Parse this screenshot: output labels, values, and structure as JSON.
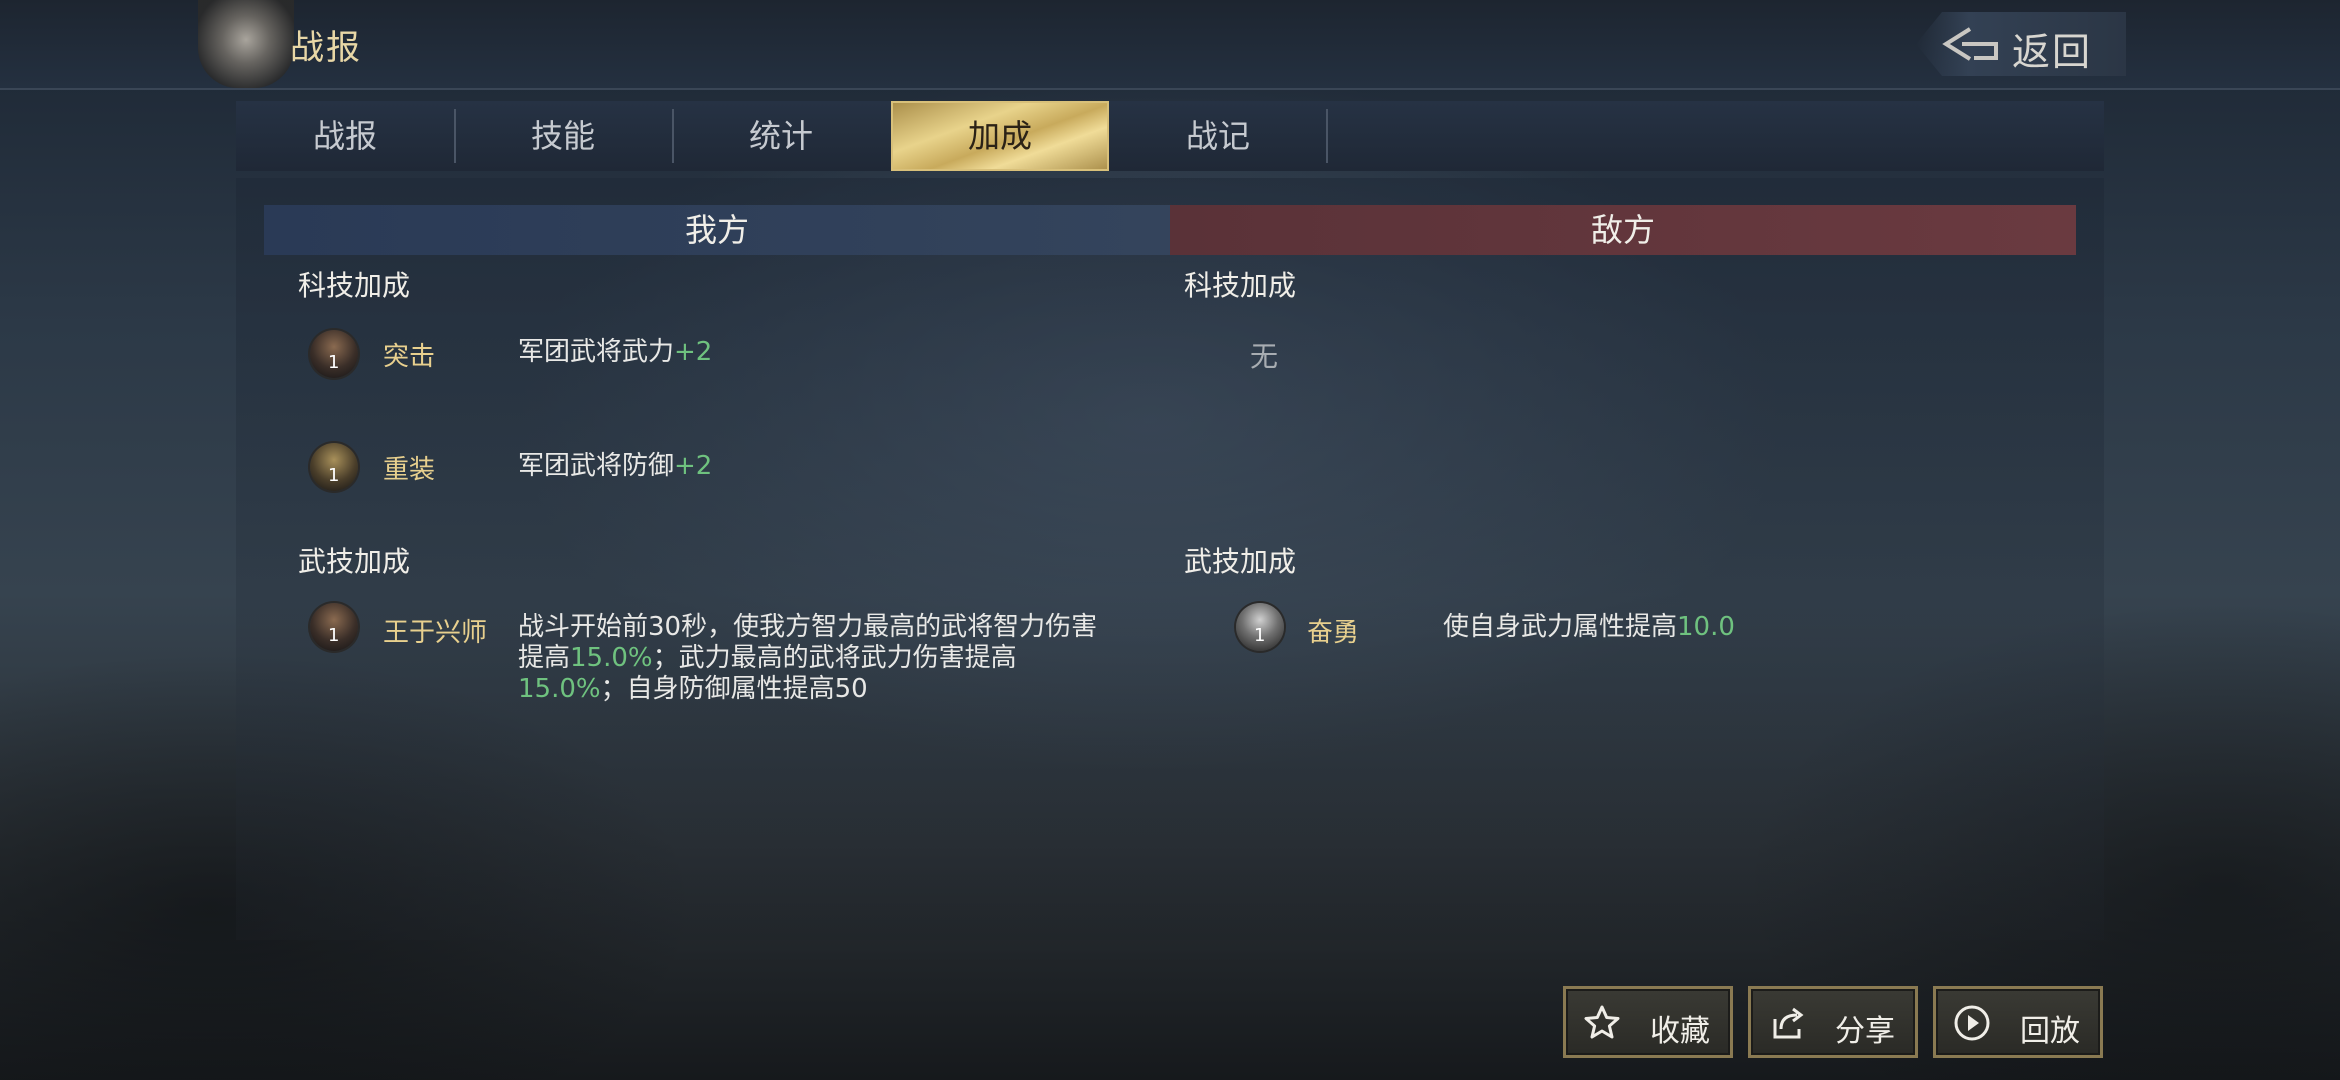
{
  "header": {
    "title": "战报",
    "back_label": "返回"
  },
  "tabs": [
    {
      "label": "战报",
      "active": false
    },
    {
      "label": "技能",
      "active": false
    },
    {
      "label": "统计",
      "active": false
    },
    {
      "label": "加成",
      "active": true
    },
    {
      "label": "战记",
      "active": false
    }
  ],
  "ours": {
    "title": "我方",
    "tech_section": "科技加成",
    "tech_items": [
      {
        "icon": "assault-unit-icon",
        "level": "1",
        "name": "突击",
        "desc_prefix": "军团武将武力",
        "desc_value": "+2"
      },
      {
        "icon": "heavy-armor-unit-icon",
        "level": "1",
        "name": "重装",
        "desc_prefix": "军团武将防御",
        "desc_value": "+2"
      }
    ],
    "skill_section": "武技加成",
    "skill_items": [
      {
        "icon": "general-portrait-icon",
        "level": "1",
        "name": "王于兴师",
        "desc_parts": [
          "战斗开始前30秒，使我方智力最高的武将智力伤害提高",
          "15.0%",
          "；武力最高的武将武力伤害提高",
          "15.0%",
          "；自身防御属性提高50"
        ]
      }
    ]
  },
  "enemy": {
    "title": "敌方",
    "tech_section": "科技加成",
    "tech_none": "无",
    "skill_section": "武技加成",
    "skill_items": [
      {
        "icon": "general-portrait-icon",
        "level": "1",
        "name": "奋勇",
        "desc_prefix": "使自身武力属性提高",
        "desc_value": "10.0"
      }
    ]
  },
  "footer": {
    "favorite_label": "收藏",
    "share_label": "分享",
    "replay_label": "回放"
  },
  "colors": {
    "accent_gold": "#e8d08e",
    "bonus_green": "#6fc27f",
    "ours_header": "#34445c",
    "enemy_header": "#6a3a40"
  }
}
